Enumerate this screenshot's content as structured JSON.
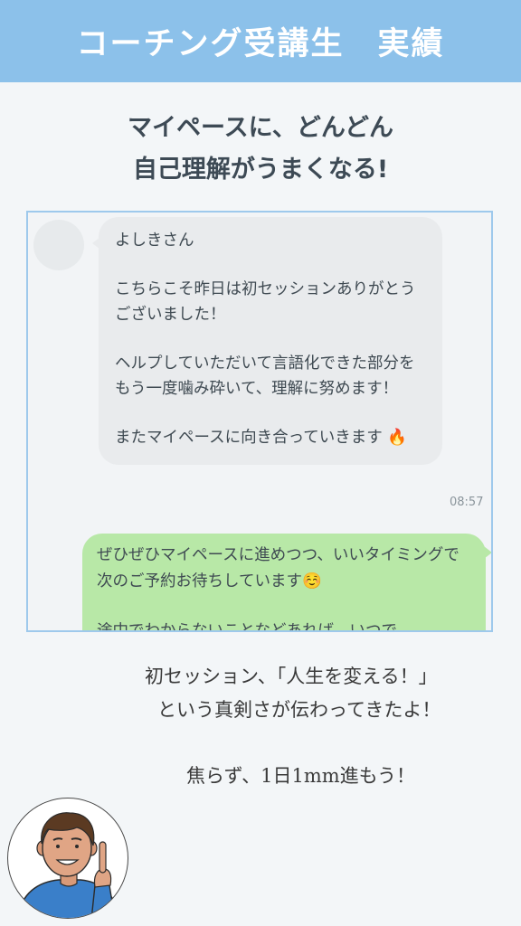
{
  "header": {
    "title": "コーチング受講生　実績",
    "background_color": "#8cc1ea"
  },
  "headline": {
    "line1": "マイペースに、どんどん",
    "line2": "自己理解がうまくなる!"
  },
  "chat": {
    "incoming": {
      "paragraphs": [
        "よしきさん",
        "こちらこそ昨日は初セッションありがとうございました！",
        "ヘルプしていただいて言語化できた部分をもう一度噛み砕いて、理解に努めます！",
        "またマイペースに向き合っていきます 🔥"
      ],
      "time": "08:57"
    },
    "outgoing": {
      "paragraphs": [
        "ぜひぜひマイペースに進めつつ、いいタイミングで次のご予約お待ちしています☺️",
        "途中でわからないことなどあれば、いつで"
      ]
    }
  },
  "comment": {
    "line1": "初セッション、「人生を変える！」",
    "line2": "という真剣さが伝わってきたよ！",
    "line3": "焦らず、1日1mm進もう！"
  },
  "coach": {
    "icon": "coach-pointing-illustration"
  }
}
